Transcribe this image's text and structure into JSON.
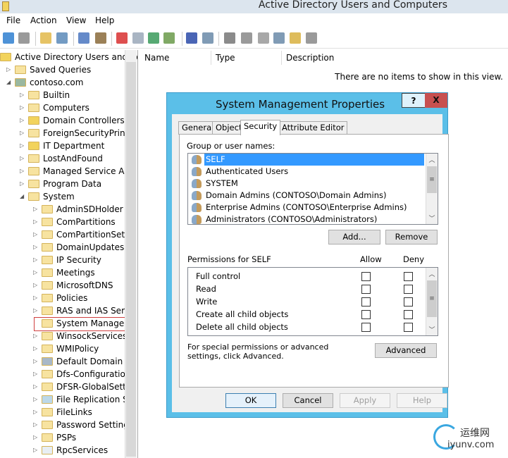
{
  "window": {
    "title": "Active Directory Users and Computers"
  },
  "menu": [
    "File",
    "Action",
    "View",
    "Help"
  ],
  "toolbar": [
    "back-icon",
    "forward-icon",
    "up-folder-icon",
    "show-console-tree-icon",
    "cut-icon",
    "paste-icon",
    "delete-icon",
    "properties-icon",
    "refresh-icon",
    "export-list-icon",
    "help-icon",
    "show-action-pane-icon",
    "new-user-icon",
    "new-group-icon",
    "new-ou-icon",
    "filter-icon",
    "find-icon",
    "add-to-group-icon"
  ],
  "tree": [
    {
      "level": 0,
      "exp": "",
      "icon": "snapin",
      "label": "Active Directory Users and Co"
    },
    {
      "level": 1,
      "exp": "closed",
      "icon": "folder",
      "label": "Saved Queries"
    },
    {
      "level": 1,
      "exp": "open",
      "icon": "domain",
      "label": "contoso.com"
    },
    {
      "level": 2,
      "exp": "closed",
      "icon": "folder",
      "label": "Builtin"
    },
    {
      "level": 2,
      "exp": "closed",
      "icon": "folder",
      "label": "Computers"
    },
    {
      "level": 2,
      "exp": "closed",
      "icon": "ou",
      "label": "Domain Controllers"
    },
    {
      "level": 2,
      "exp": "closed",
      "icon": "folder",
      "label": "ForeignSecurityPrinci"
    },
    {
      "level": 2,
      "exp": "closed",
      "icon": "ou",
      "label": "IT Department"
    },
    {
      "level": 2,
      "exp": "closed",
      "icon": "folder",
      "label": "LostAndFound"
    },
    {
      "level": 2,
      "exp": "closed",
      "icon": "folder",
      "label": "Managed Service Acc"
    },
    {
      "level": 2,
      "exp": "closed",
      "icon": "folder",
      "label": "Program Data"
    },
    {
      "level": 2,
      "exp": "open",
      "icon": "folder",
      "label": "System"
    },
    {
      "level": 3,
      "exp": "closed",
      "icon": "folder",
      "label": "AdminSDHolder"
    },
    {
      "level": 3,
      "exp": "closed",
      "icon": "folder",
      "label": "ComPartitions"
    },
    {
      "level": 3,
      "exp": "closed",
      "icon": "folder",
      "label": "ComPartitionSets"
    },
    {
      "level": 3,
      "exp": "closed",
      "icon": "folder",
      "label": "DomainUpdates"
    },
    {
      "level": 3,
      "exp": "closed",
      "icon": "folder",
      "label": "IP Security"
    },
    {
      "level": 3,
      "exp": "closed",
      "icon": "folder",
      "label": "Meetings"
    },
    {
      "level": 3,
      "exp": "closed",
      "icon": "folder",
      "label": "MicrosoftDNS"
    },
    {
      "level": 3,
      "exp": "closed",
      "icon": "folder",
      "label": "Policies"
    },
    {
      "level": 3,
      "exp": "closed",
      "icon": "folder",
      "label": "RAS and IAS Serve"
    },
    {
      "level": 3,
      "exp": "",
      "icon": "folder",
      "label": "System Managem",
      "selected": true
    },
    {
      "level": 3,
      "exp": "closed",
      "icon": "folder",
      "label": "WinsockServices"
    },
    {
      "level": 3,
      "exp": "closed",
      "icon": "folder",
      "label": "WMIPolicy"
    },
    {
      "level": 3,
      "exp": "closed",
      "icon": "gpo",
      "label": "Default Domain P"
    },
    {
      "level": 3,
      "exp": "closed",
      "icon": "folder",
      "label": "Dfs-Configuration"
    },
    {
      "level": 3,
      "exp": "closed",
      "icon": "folder",
      "label": "DFSR-GlobalSettin"
    },
    {
      "level": 3,
      "exp": "closed",
      "icon": "frs",
      "label": "File Replication Se"
    },
    {
      "level": 3,
      "exp": "closed",
      "icon": "folder",
      "label": "FileLinks"
    },
    {
      "level": 3,
      "exp": "closed",
      "icon": "folder",
      "label": "Password Settings"
    },
    {
      "level": 3,
      "exp": "closed",
      "icon": "folder",
      "label": "PSPs"
    },
    {
      "level": 3,
      "exp": "closed",
      "icon": "rpc",
      "label": "RpcServices"
    }
  ],
  "list": {
    "columns": [
      "Name",
      "Type",
      "Description"
    ],
    "empty": "There are no items to show in this view."
  },
  "dialog": {
    "title": "System Management Properties",
    "help": "?",
    "close": "X",
    "tabs": [
      "General",
      "Object",
      "Security",
      "Attribute Editor"
    ],
    "active_tab": "Security",
    "group_label": "Group or user names:",
    "users": [
      "SELF",
      "Authenticated Users",
      "SYSTEM",
      "Domain Admins (CONTOSO\\Domain Admins)",
      "Enterprise Admins (CONTOSO\\Enterprise Admins)",
      "Administrators (CONTOSO\\Administrators)"
    ],
    "add": "Add...",
    "remove": "Remove",
    "perm_label": "Permissions for SELF",
    "allow": "Allow",
    "deny": "Deny",
    "permissions": [
      {
        "name": "Full control",
        "allow": false,
        "deny": false
      },
      {
        "name": "Read",
        "allow": false,
        "deny": false
      },
      {
        "name": "Write",
        "allow": false,
        "deny": false
      },
      {
        "name": "Create all child objects",
        "allow": false,
        "deny": false
      },
      {
        "name": "Delete all child objects",
        "allow": false,
        "deny": false
      }
    ],
    "advanced_text": "For special permissions or advanced settings, click Advanced.",
    "advanced": "Advanced",
    "ok": "OK",
    "cancel": "Cancel",
    "apply": "Apply",
    "help_btn": "Help"
  },
  "watermark": {
    "cn": "运维网",
    "url": "iyunv.com"
  }
}
